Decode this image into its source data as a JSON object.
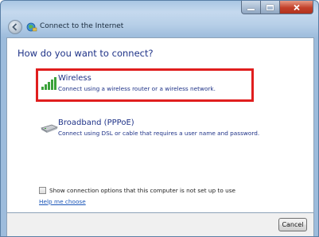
{
  "window": {
    "title": "Connect to the Internet",
    "back_icon": "back-arrow-icon",
    "app_icon": "network-globe-icon"
  },
  "main": {
    "heading": "How do you want to connect?",
    "options": [
      {
        "title": "Wireless",
        "description": "Connect using a wireless router or a wireless network.",
        "icon": "wireless-signal-icon",
        "highlighted": true,
        "highlight_color": "#e01e1e"
      },
      {
        "title": "Broadband (PPPoE)",
        "description": "Connect using DSL or cable that requires a user name and password.",
        "icon": "broadband-modem-icon",
        "highlighted": false
      }
    ],
    "show_options_label": "Show connection options that this computer is not set up to use",
    "show_options_checked": false,
    "help_link": "Help me choose"
  },
  "footer": {
    "cancel_label": "Cancel"
  },
  "colors": {
    "heading": "#1e3287",
    "link": "#1a55b8",
    "title_bar": "#b7cfe8"
  }
}
